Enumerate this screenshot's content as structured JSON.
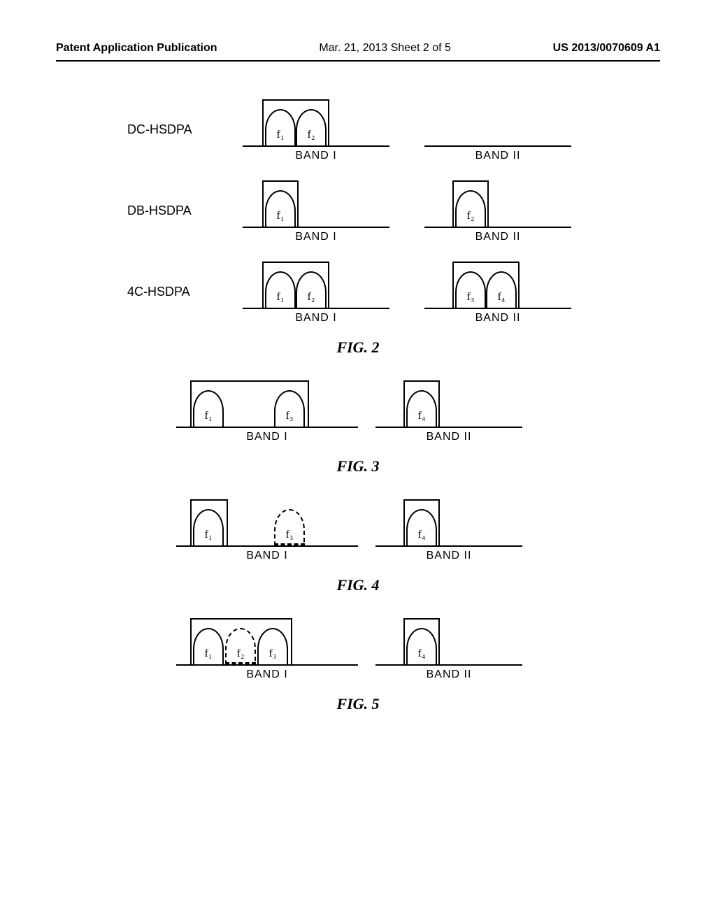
{
  "header": {
    "left": "Patent Application Publication",
    "middle": "Mar. 21, 2013  Sheet 2 of 5",
    "right": "US 2013/0070609 A1"
  },
  "labels": {
    "band1": "BAND I",
    "band2": "BAND II"
  },
  "rows": {
    "dc": {
      "label": "DC-HSDPA",
      "f1": "f₁",
      "f2": "f₂"
    },
    "db": {
      "label": "DB-HSDPA",
      "f1": "f₁",
      "f2": "f₂"
    },
    "fc": {
      "label": "4C-HSDPA",
      "f1": "f₁",
      "f2": "f₂",
      "f3": "f₃",
      "f4": "f₄"
    }
  },
  "fig3": {
    "f1": "f₁",
    "f3": "f₃",
    "f4": "f₄"
  },
  "fig4": {
    "f1": "f₁",
    "f3": "f₃",
    "f4": "f₄"
  },
  "fig5": {
    "f1": "f₁",
    "f2": "f₂",
    "f3": "f₃",
    "f4": "f₄"
  },
  "captions": {
    "fig2": "FIG. 2",
    "fig3": "FIG. 3",
    "fig4": "FIG. 4",
    "fig5": "FIG. 5"
  },
  "chart_data": [
    {
      "type": "bar",
      "figure": "FIG. 2",
      "subfigures": [
        {
          "mode": "DC-HSDPA",
          "band_I_carriers": [
            "f1",
            "f2"
          ],
          "band_I_contiguous_group": [
            "f1",
            "f2"
          ],
          "band_II_carriers": []
        },
        {
          "mode": "DB-HSDPA",
          "band_I_carriers": [
            "f1"
          ],
          "band_I_contiguous_group": [
            "f1"
          ],
          "band_II_carriers": [
            "f2"
          ],
          "band_II_contiguous_group": [
            "f2"
          ]
        },
        {
          "mode": "4C-HSDPA",
          "band_I_carriers": [
            "f1",
            "f2"
          ],
          "band_I_contiguous_group": [
            "f1",
            "f2"
          ],
          "band_II_carriers": [
            "f3",
            "f4"
          ],
          "band_II_contiguous_group": [
            "f3",
            "f4"
          ]
        }
      ]
    },
    {
      "type": "bar",
      "figure": "FIG. 3",
      "band_I_carriers": [
        "f1",
        "f3"
      ],
      "band_I_grouped": [
        "f1",
        "f3"
      ],
      "band_I_gap_between": [
        "f1",
        "f3"
      ],
      "band_II_carriers": [
        "f4"
      ],
      "band_II_grouped": [
        "f4"
      ]
    },
    {
      "type": "bar",
      "figure": "FIG. 4",
      "band_I_carriers": [
        "f1",
        "f3"
      ],
      "band_I_grouped": [
        "f1"
      ],
      "band_I_deactivated": [
        "f3"
      ],
      "band_I_gap_between": [
        "f1",
        "f3"
      ],
      "band_II_carriers": [
        "f4"
      ],
      "band_II_grouped": [
        "f4"
      ]
    },
    {
      "type": "bar",
      "figure": "FIG. 5",
      "band_I_carriers": [
        "f1",
        "f2",
        "f3"
      ],
      "band_I_grouped": [
        "f1",
        "f2",
        "f3"
      ],
      "band_I_deactivated": [
        "f2"
      ],
      "band_II_carriers": [
        "f4"
      ],
      "band_II_grouped": [
        "f4"
      ]
    }
  ]
}
